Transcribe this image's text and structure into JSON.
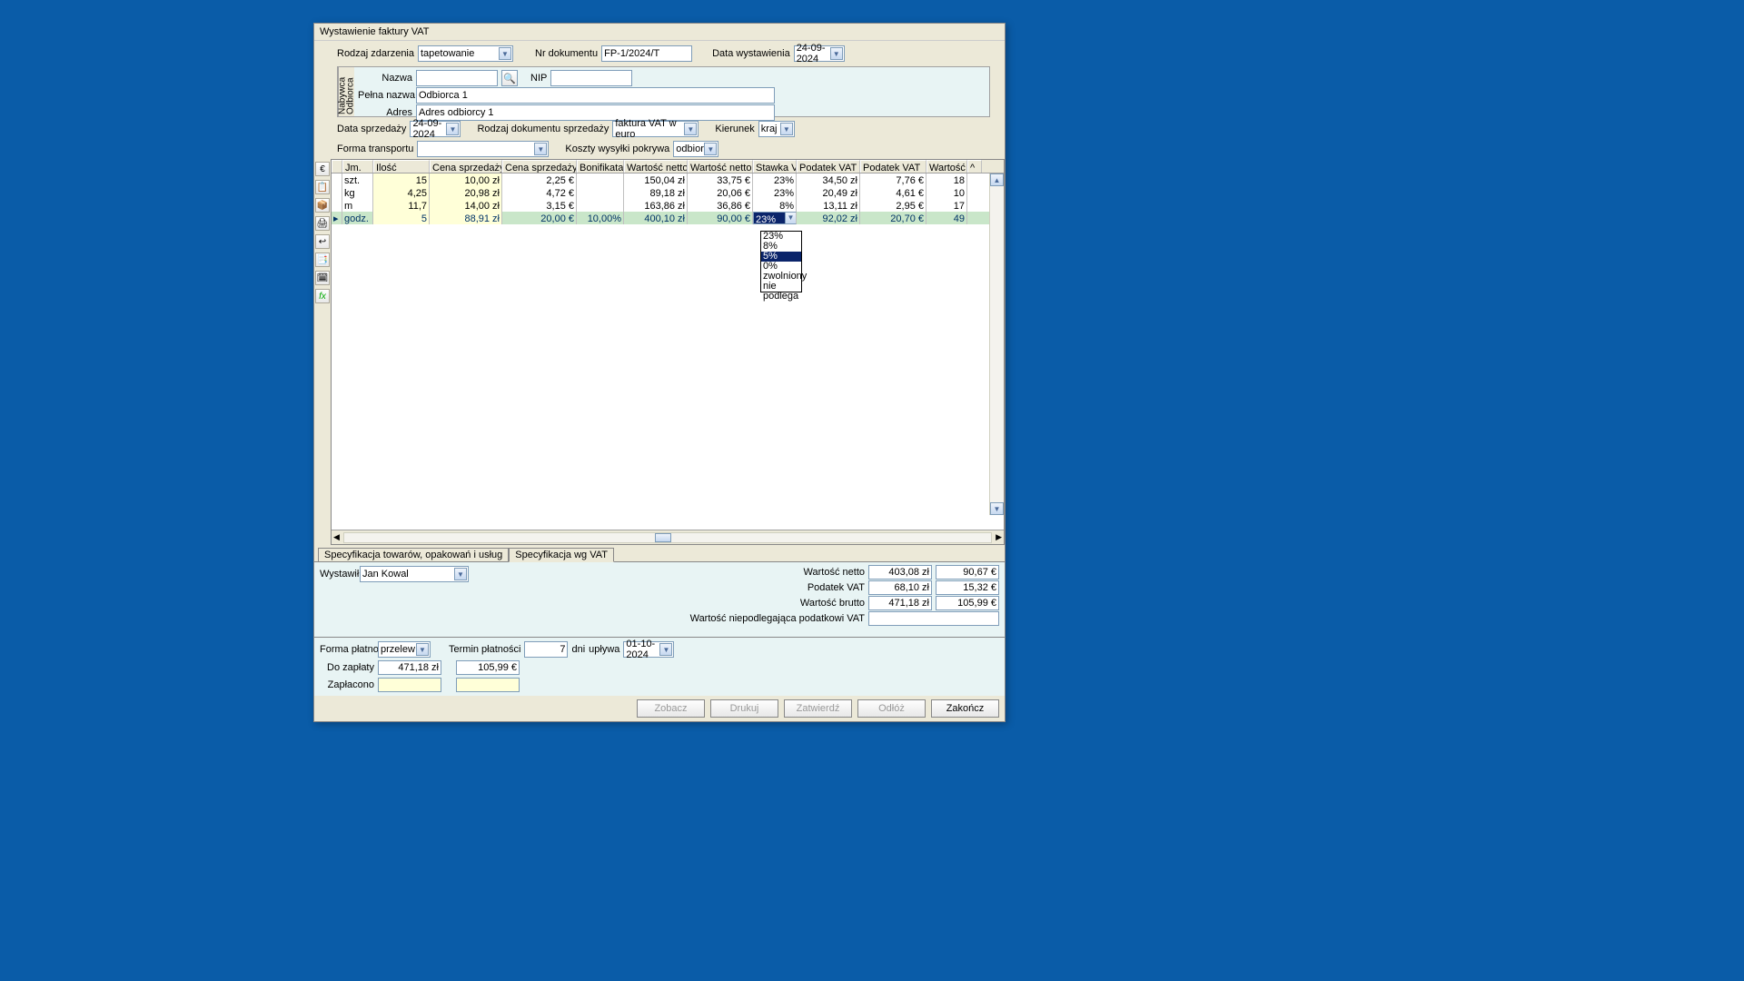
{
  "title": "Wystawienie faktury VAT",
  "topRow": {
    "rodzajZdarzeniaLabel": "Rodzaj zdarzenia",
    "rodzajZdarzenia": "tapetowanie",
    "nrDokumentuLabel": "Nr dokumentu",
    "nrDokumentu": "FP-1/2024/T",
    "dataWystawieniaLabel": "Data wystawienia",
    "dataWystawienia": "24-09-2024"
  },
  "buyer": {
    "tab": "Nabywca\nOdbiorca",
    "nazwaLabel": "Nazwa",
    "nazwa": "",
    "nipLabel": "NIP",
    "nip": "",
    "pelnaNazwaLabel": "Pełna nazwa",
    "pelnaNazwa": "Odbiorca 1",
    "adresLabel": "Adres",
    "adres": "Adres odbiorcy 1"
  },
  "row3": {
    "dataSprzedazyLabel": "Data sprzedaży",
    "dataSprzedazy": "24-09-2024",
    "rodzajDokLabel": "Rodzaj dokumentu sprzedaży",
    "rodzajDok": "faktura VAT w euro",
    "kierunekLabel": "Kierunek",
    "kierunek": "kraj",
    "formaTransportuLabel": "Forma transportu",
    "formaTransportu": "",
    "kosztyWysylkiLabel": "Koszty wysyłki pokrywa",
    "kosztyWysylki": "odbiorca"
  },
  "grid": {
    "headers": [
      "",
      "Jm.",
      "Ilość",
      "Cena sprzedaży netto",
      "Cena sprzedaży netto",
      "Bonifikata",
      "Wartość netto",
      "Wartość netto",
      "Stawka VAT",
      "Podatek VAT",
      "Podatek VAT",
      "Wartość bru",
      "^"
    ],
    "rows": [
      {
        "jm": "szt.",
        "ilosc": "15",
        "csn": "10,00 zł",
        "csne": "2,25 €",
        "bon": "",
        "wn": "150,04 zł",
        "wne": "33,75 €",
        "svat": "23%",
        "pvat": "34,50 zł",
        "pvate": "7,76 €",
        "wb": "18"
      },
      {
        "jm": "kg",
        "ilosc": "4,25",
        "csn": "20,98 zł",
        "csne": "4,72 €",
        "bon": "",
        "wn": "89,18 zł",
        "wne": "20,06 €",
        "svat": "23%",
        "pvat": "20,49 zł",
        "pvate": "4,61 €",
        "wb": "10"
      },
      {
        "jm": "m",
        "ilosc": "11,7",
        "csn": "14,00 zł",
        "csne": "3,15 €",
        "bon": "",
        "wn": "163,86 zł",
        "wne": "36,86 €",
        "svat": "8%",
        "pvat": "13,11 zł",
        "pvate": "2,95 €",
        "wb": "17"
      },
      {
        "jm": "godz.",
        "ilosc": "5",
        "csn": "88,91 zł",
        "csne": "20,00 €",
        "bon": "10,00%",
        "wn": "400,10 zł",
        "wne": "90,00 €",
        "svat": "23%",
        "pvat": "92,02 zł",
        "pvate": "20,70 €",
        "wb": "49"
      }
    ],
    "vatOptions": [
      "23%",
      "8%",
      "5%",
      "0%",
      "zwolniony",
      "nie podlega"
    ],
    "vatHighlighted": "5%"
  },
  "tabs": {
    "spec1": "Specyfikacja towarów, opakowań i usług",
    "spec2": "Specyfikacja wg VAT"
  },
  "issuer": {
    "label": "Wystawił",
    "value": "Jan Kowal"
  },
  "totals": {
    "wartoscNettoLabel": "Wartość netto",
    "wartoscNettoZl": "403,08 zł",
    "wartoscNettoE": "90,67 €",
    "podatekVatLabel": "Podatek VAT",
    "podatekVatZl": "68,10 zł",
    "podatekVatE": "15,32 €",
    "wartoscBruttoLabel": "Wartość brutto",
    "wartoscBruttoZl": "471,18 zł",
    "wartoscBruttoE": "105,99 €",
    "niepodlegajacaLabel": "Wartość niepodlegająca podatkowi VAT",
    "niepodlegajaca": ""
  },
  "payment": {
    "formaPlatnosciLabel": "Forma płatności",
    "formaPlatnosci": "przelew",
    "terminPlatnosciLabel": "Termin płatności",
    "terminPlatnosci": "7",
    "dniLabel": "dni",
    "uplywaLabel": "upływa",
    "uplywa": "01-10-2024",
    "doZaplatyLabel": "Do zapłaty",
    "doZaplatyZl": "471,18 zł",
    "doZaplatyE": "105,99 €",
    "zaplaconoLabel": "Zapłacono",
    "zaplaconoZl": "",
    "zaplaconoE": ""
  },
  "buttons": {
    "zobacz": "Zobacz",
    "drukuj": "Drukuj",
    "zatwierdz": "Zatwierdź",
    "odloz": "Odłóż",
    "zakoncz": "Zakończ"
  },
  "sideIcons": [
    "€",
    "📋",
    "📦",
    "🖨",
    "↩",
    "📑",
    "🗓",
    "fx"
  ]
}
